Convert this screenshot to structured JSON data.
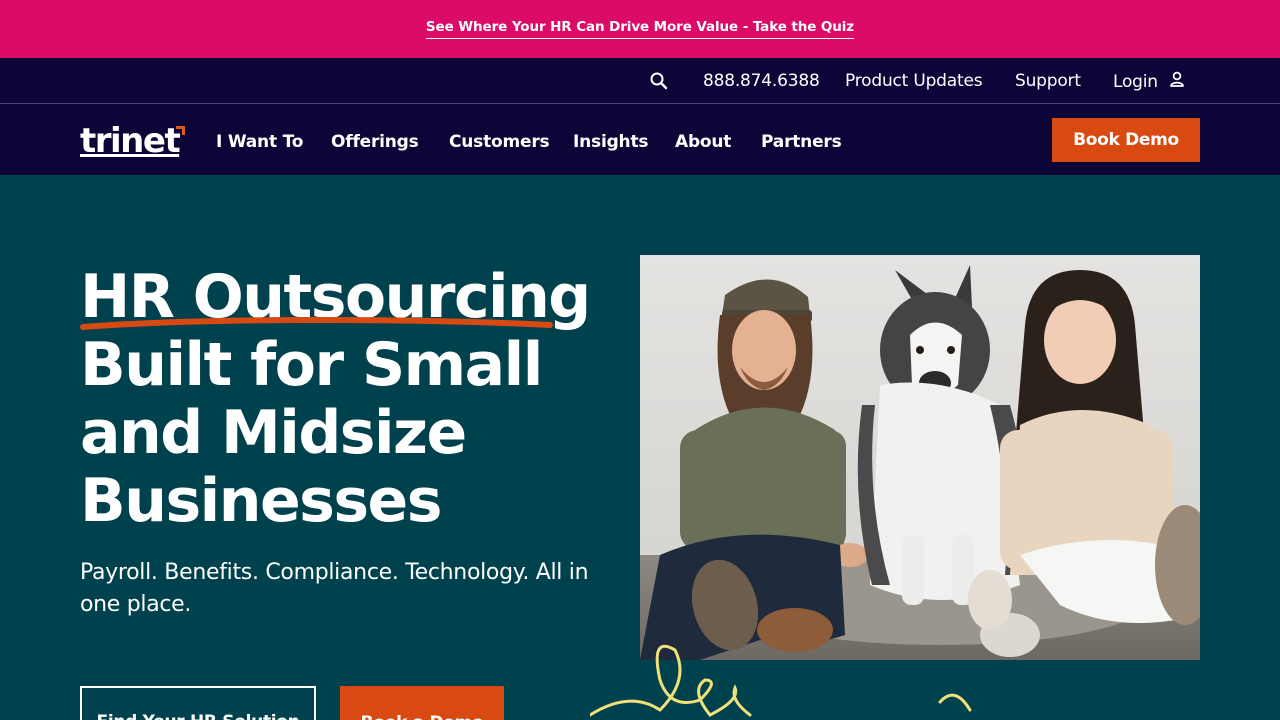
{
  "promo": {
    "text": "See Where Your HR Can Drive More Value - Take the Quiz"
  },
  "utility": {
    "search_icon": "search-icon",
    "phone": "888.874.6388",
    "product_updates": "Product Updates",
    "support": "Support",
    "login": "Login",
    "login_icon": "user-icon"
  },
  "nav": {
    "logo": "trinet",
    "items": [
      "I Want To",
      "Offerings",
      "Customers",
      "Insights",
      "About",
      "Partners"
    ],
    "book_demo": "Book Demo"
  },
  "hero": {
    "headline_lines": [
      "HR Outsourcing",
      "Built for Small",
      "and Midsize",
      "Businesses"
    ],
    "subhead": "Payroll. Benefits. Compliance. Technology. All in one place.",
    "cta_primary": "Find Your HR Solution",
    "cta_secondary": "Book a Demo",
    "photo": "photo of two people sitting on the floor with a husky dog"
  },
  "colors": {
    "promo_bg": "#dc0b67",
    "nav_bg": "#0c0538",
    "hero_bg": "#00414e",
    "accent_orange": "#d94a12",
    "scribble_yellow": "#f2e07a"
  }
}
